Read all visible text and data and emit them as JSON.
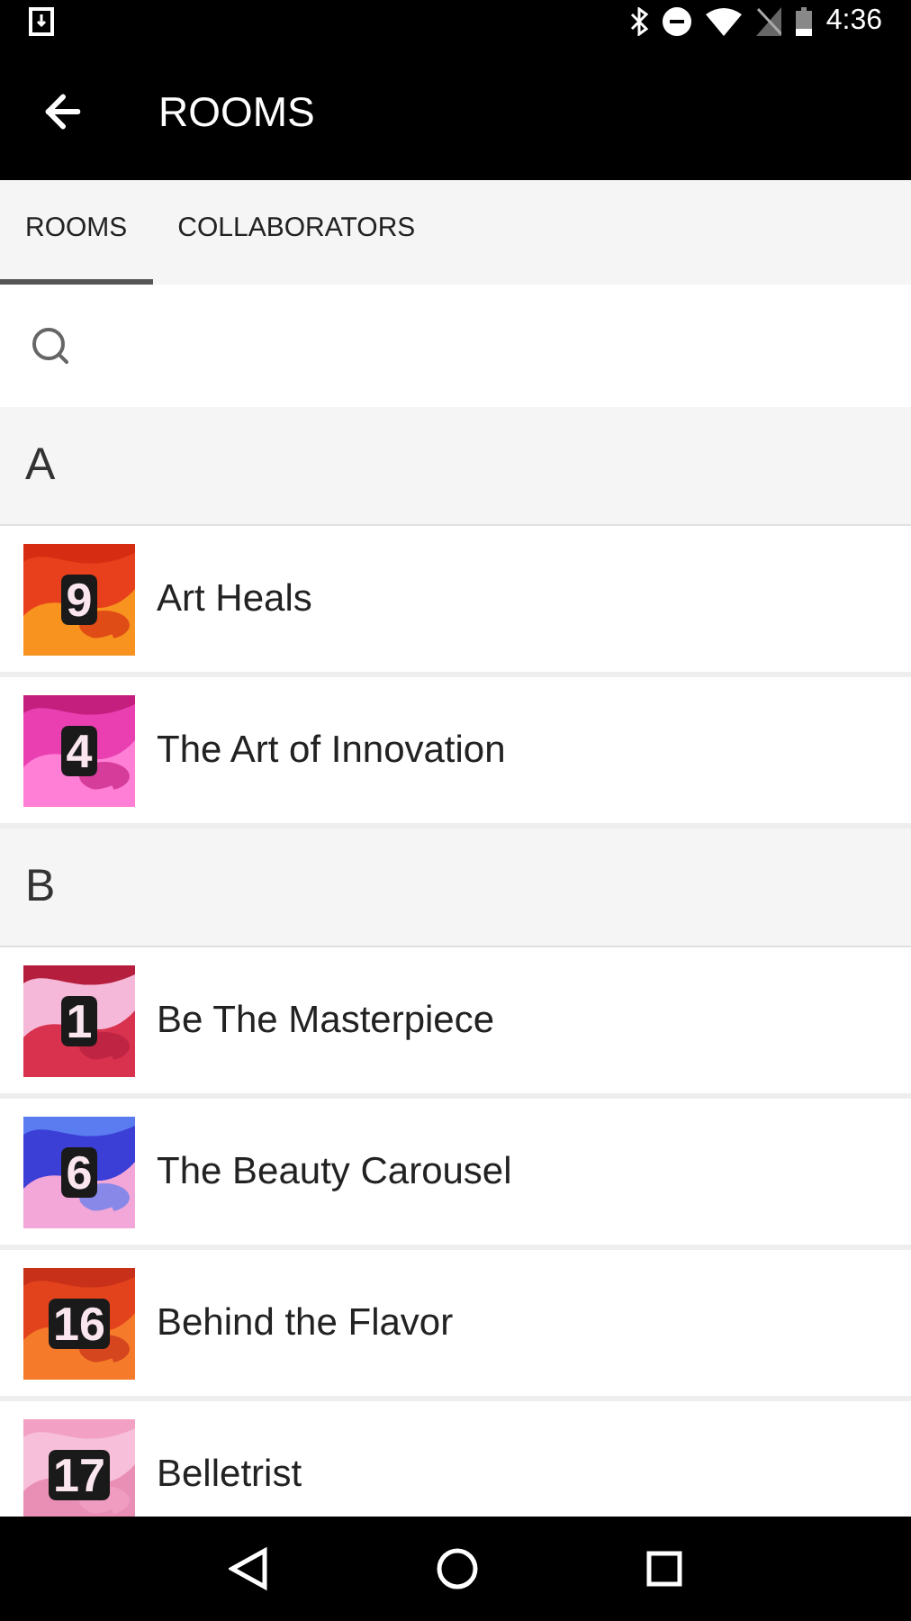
{
  "status_bar": {
    "time": "4:36"
  },
  "app_bar": {
    "title": "ROOMS"
  },
  "tabs": [
    {
      "label": "ROOMS",
      "selected": true
    },
    {
      "label": "COLLABORATORS",
      "selected": false
    }
  ],
  "sections": [
    {
      "letter": "A",
      "rooms": [
        {
          "number": "9",
          "name": "Art Heals"
        },
        {
          "number": "4",
          "name": "The Art of Innovation"
        }
      ]
    },
    {
      "letter": "B",
      "rooms": [
        {
          "number": "1",
          "name": "Be The Masterpiece"
        },
        {
          "number": "6",
          "name": "The Beauty Carousel"
        },
        {
          "number": "16",
          "name": "Behind the Flavor"
        },
        {
          "number": "17",
          "name": "Belletrist"
        }
      ]
    }
  ]
}
